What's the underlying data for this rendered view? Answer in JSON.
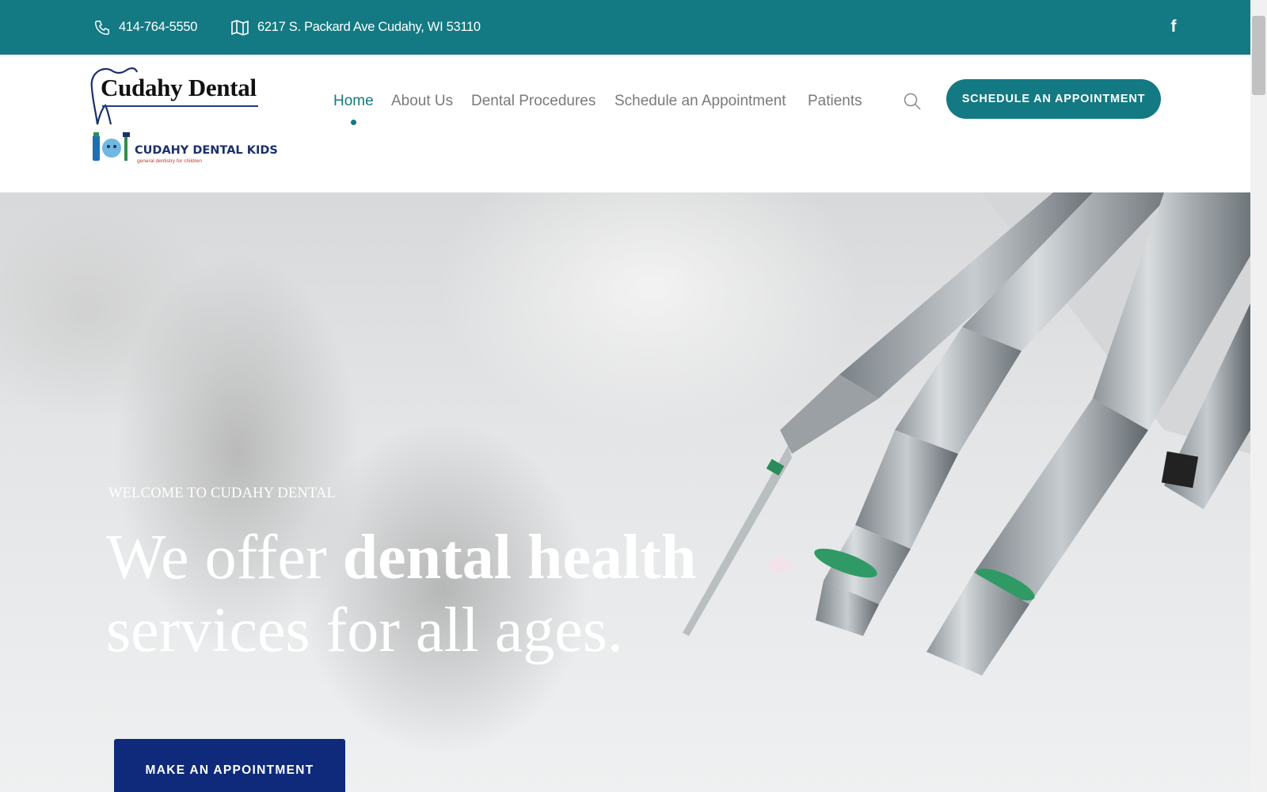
{
  "topbar": {
    "phone": "414-764-5550",
    "address": "6217 S. Packard Ave Cudahy, WI 53110",
    "social_icon": "facebook-icon"
  },
  "logo": {
    "brand": "Cudahy Dental",
    "kids": "CUDAHY DENTAL KIDS",
    "tagline": "general dentistry for children"
  },
  "nav": {
    "items": [
      {
        "label": "Home",
        "active": true
      },
      {
        "label": "About Us"
      },
      {
        "label": "Dental Procedures"
      },
      {
        "label": "Schedule an Appointment"
      },
      {
        "label": "Patients"
      }
    ]
  },
  "header": {
    "search_icon": "search-icon",
    "cta_label": "SCHEDULE AN APPOINTMENT"
  },
  "hero": {
    "eyebrow": "WELCOME TO CUDAHY DENTAL",
    "headline_part1": "We offer ",
    "headline_bold": "dental health",
    "headline_part2": "services for all ages.",
    "button_label": "MAKE AN APPOINTMENT"
  },
  "colors": {
    "brand_teal": "#137982",
    "button_navy": "#0f2a7a"
  }
}
